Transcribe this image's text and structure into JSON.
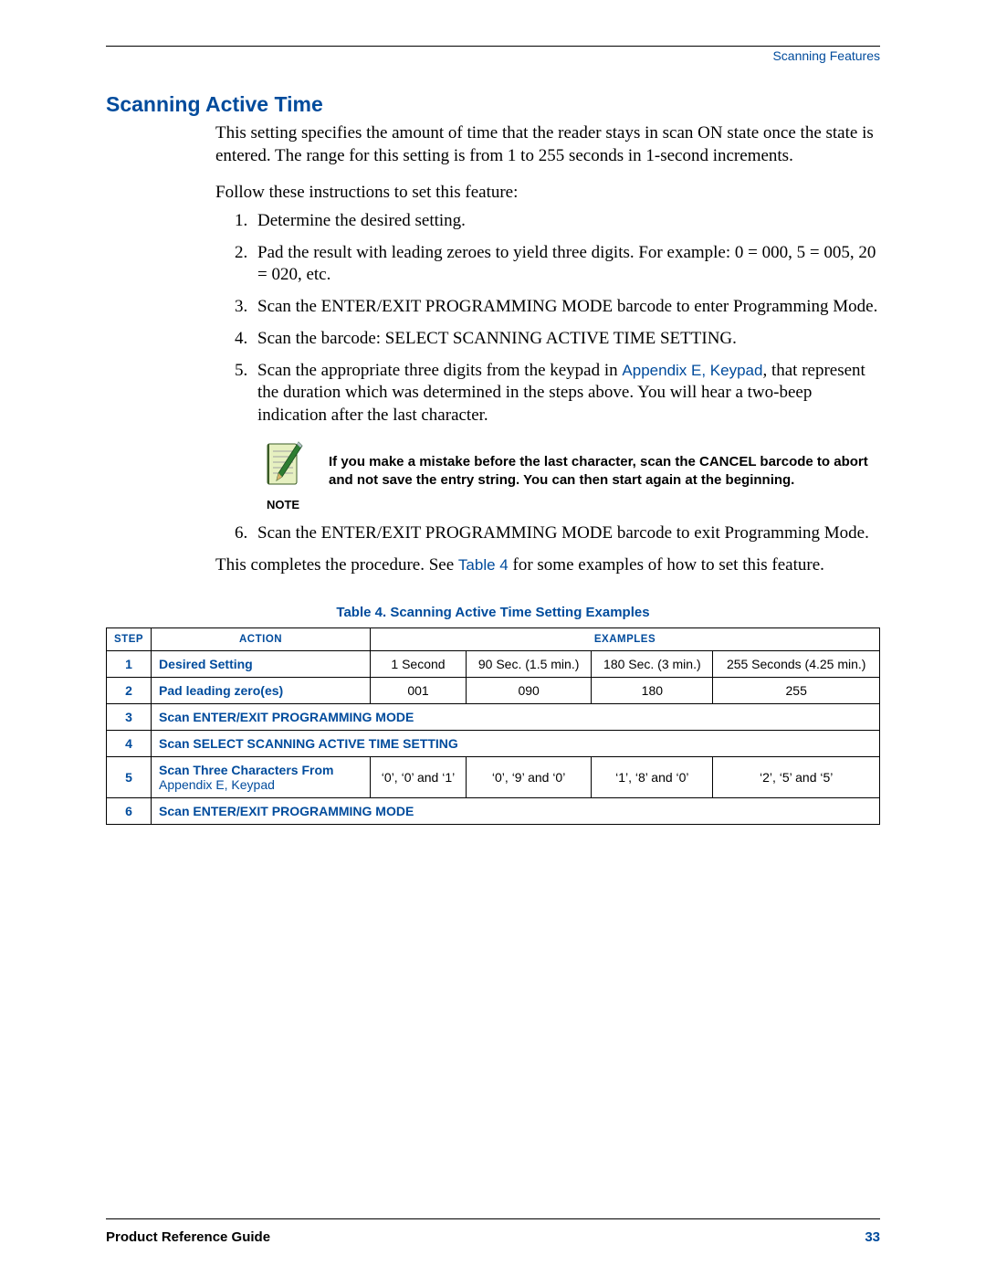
{
  "header": {
    "section_label": "Scanning Features"
  },
  "title": "Scanning Active Time",
  "intro": "This setting specifies the amount of time that the reader stays in scan ON state once the state is entered. The range for this setting is from 1 to 255 seconds in 1-second increments.",
  "follow_instr": "Follow these instructions to set this feature:",
  "steps": {
    "s1": "Determine the desired setting.",
    "s2": "Pad the result with leading zeroes to yield three digits. For example: 0 = 000, 5 = 005, 20 = 020, etc.",
    "s3": "Scan the ENTER/EXIT PROGRAMMING MODE barcode to enter Programming Mode.",
    "s4": "Scan the barcode: SELECT SCANNING ACTIVE TIME SETTING.",
    "s5_pre": "Scan the appropriate three digits from the keypad in ",
    "s5_link": "Appendix E, Keypad",
    "s5_post": ", that represent the duration which was determined in the steps above. You will hear a two-beep indication after the last character.",
    "s6": "Scan the ENTER/EXIT PROGRAMMING MODE barcode to exit Programming Mode."
  },
  "note": {
    "caption": "NOTE",
    "text": "If you make a mistake before the last character, scan the CANCEL barcode to abort and not save the entry string. You can then start again at the beginning."
  },
  "completion_pre": "This completes the procedure. See ",
  "completion_link": "Table 4",
  "completion_post": " for some examples of how to set this feature.",
  "table": {
    "caption": "Table 4. Scanning Active Time Setting Examples",
    "headers": {
      "step": "STEP",
      "action": "ACTION",
      "examples": "EXAMPLES"
    },
    "rows": {
      "r1": {
        "step": "1",
        "action": "Desired Setting",
        "c1": "1 Second",
        "c2": "90 Sec. (1.5 min.)",
        "c3": "180 Sec. (3 min.)",
        "c4": "255 Seconds (4.25 min.)"
      },
      "r2": {
        "step": "2",
        "action": "Pad leading zero(es)",
        "c1": "001",
        "c2": "090",
        "c3": "180",
        "c4": "255"
      },
      "r3": {
        "step": "3",
        "action": "Scan ENTER/EXIT PROGRAMMING MODE"
      },
      "r4": {
        "step": "4",
        "action": "Scan SELECT SCANNING ACTIVE TIME SETTING"
      },
      "r5": {
        "step": "5",
        "action_bold": "Scan Three Characters From ",
        "action_link": "Appendix E, Keypad",
        "c1": "‘0’, ‘0’ and ‘1’",
        "c2": "‘0’, ‘9’ and ‘0’",
        "c3": "‘1’, ‘8’ and ‘0’",
        "c4": "‘2’, ‘5’ and ‘5’"
      },
      "r6": {
        "step": "6",
        "action": "Scan ENTER/EXIT PROGRAMMING MODE"
      }
    }
  },
  "footer": {
    "guide": "Product Reference Guide",
    "page": "33"
  }
}
